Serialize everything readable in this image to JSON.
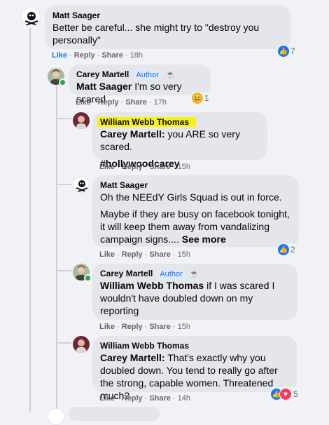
{
  "comments": [
    {
      "author": "Matt Saager",
      "text": "Better be careful... she might try to \"destroy you personally\"",
      "actions": {
        "like": "Like",
        "reply": "Reply",
        "share": "Share",
        "time": "18h"
      },
      "reaction": {
        "type": "like",
        "count": "7"
      }
    },
    {
      "author": "Carey Martell",
      "badge": "Author",
      "mention": "Matt Saager",
      "text": " I'm so very scared",
      "actions": {
        "like": "Like",
        "reply": "Reply",
        "share": "Share",
        "time": "17h"
      },
      "reaction": {
        "type": "haha",
        "count": "1"
      }
    },
    {
      "author": "William Webb Thomas",
      "mention": "Carey Martell:",
      "text": " you ARE so very scared.",
      "hashtag": "#hollywoodcarey",
      "actions": {
        "like": "Like",
        "reply": "Reply",
        "share": "Share",
        "time": "15h"
      }
    },
    {
      "author": "Matt Saager",
      "text1": "Oh the NEEdY Girls Squad is out in force.",
      "text2": "Maybe if they are busy on facebook tonight, it will keep them away from vandalizing campaign signs.... ",
      "see_more": "See more",
      "actions": {
        "like": "Like",
        "reply": "Reply",
        "share": "Share",
        "time": "15h"
      },
      "reaction": {
        "type": "like",
        "count": "2"
      }
    },
    {
      "author": "Carey Martell",
      "badge": "Author",
      "mention": "William Webb Thomas",
      "text": " if I was scared I wouldn't have doubled down on my reporting",
      "actions": {
        "like": "Like",
        "reply": "Reply",
        "share": "Share",
        "time": "15h"
      }
    },
    {
      "author": "William Webb Thomas",
      "mention": "Carey Martell:",
      "text": " That's exactly why you doubled down. You tend to really go after the strong, capable women. Threatened much?",
      "actions": {
        "like": "Like",
        "reply": "Reply",
        "share": "Share",
        "time": "14h"
      },
      "reaction": {
        "type": "like-love",
        "count": "5"
      }
    }
  ],
  "icons": {
    "like": "thumbs-up-icon",
    "love": "heart-icon",
    "haha": "laughing-face-icon",
    "cup": "coffee-cup-icon"
  },
  "colors": {
    "bubble": "#e4e6eb",
    "background": "#f0f2f5",
    "link_blue": "#1b74e4",
    "highlight": "#f7f213",
    "meta_gray": "#65676b"
  }
}
